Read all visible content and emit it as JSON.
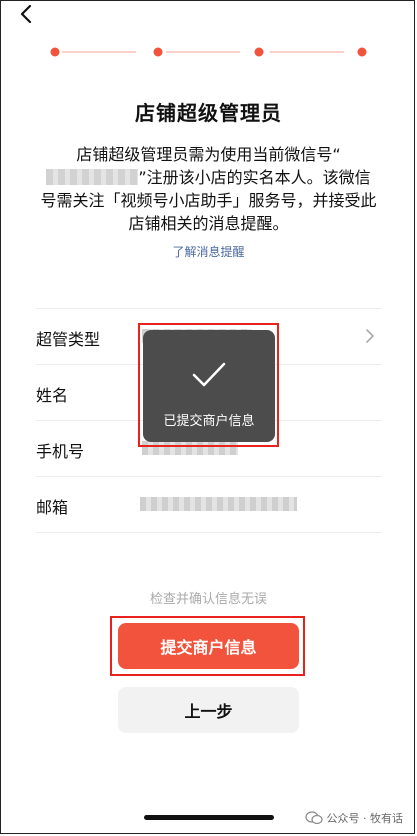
{
  "header": {
    "back_icon": "chevron-left-icon"
  },
  "steps": {
    "total": 4,
    "accent": "#f2533c"
  },
  "title": "店铺超级管理员",
  "description": {
    "part1": "店铺超级管理员需为使用当前微信号“",
    "part2": "”注册该小店的实名本人。该微信号需关注「视频号小店助手」服务号，并接受此店铺相关的消息提醒。"
  },
  "link": "了解消息提醒",
  "form": {
    "rows": [
      {
        "label": "超管类型"
      },
      {
        "label": "姓名"
      },
      {
        "label": "手机号"
      },
      {
        "label": "邮箱"
      }
    ]
  },
  "toast": {
    "message": "已提交商户信息",
    "icon": "checkmark-icon"
  },
  "hint": "检查并确认信息无误",
  "buttons": {
    "submit": "提交商户信息",
    "previous": "上一步"
  },
  "watermark": {
    "text": "公众号 · 牧有话",
    "icon": "wechat-icon"
  },
  "colors": {
    "accent": "#f2533c",
    "highlight_box": "#e8231d",
    "toast_bg": "#4c4c4c"
  }
}
